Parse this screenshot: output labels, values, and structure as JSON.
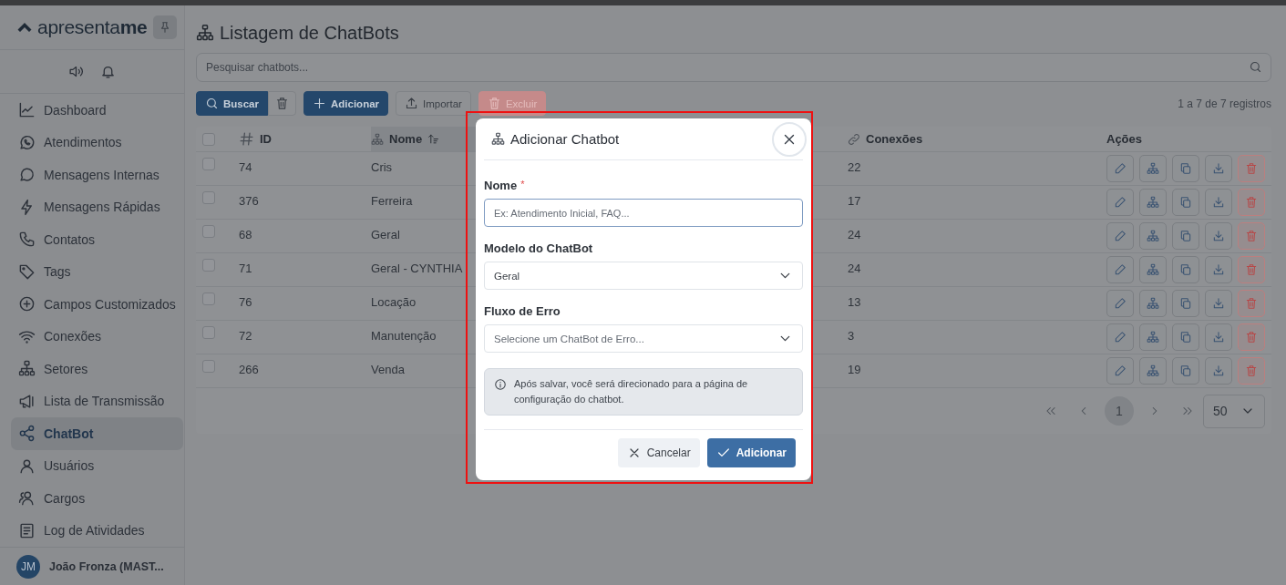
{
  "sidebar": {
    "logo": {
      "light": "apresenta",
      "bold": "me"
    },
    "items": [
      {
        "label": "Dashboard",
        "selected": false
      },
      {
        "label": "Atendimentos",
        "selected": false
      },
      {
        "label": "Mensagens Internas",
        "selected": false
      },
      {
        "label": "Mensagens Rápidas",
        "selected": false
      },
      {
        "label": "Contatos",
        "selected": false
      },
      {
        "label": "Tags",
        "selected": false
      },
      {
        "label": "Campos Customizados",
        "selected": false
      },
      {
        "label": "Conexões",
        "selected": false
      },
      {
        "label": "Setores",
        "selected": false
      },
      {
        "label": "Lista de Transmissão",
        "selected": false
      },
      {
        "label": "ChatBot",
        "selected": true
      },
      {
        "label": "Usuários",
        "selected": false
      },
      {
        "label": "Cargos",
        "selected": false
      },
      {
        "label": "Log de Atividades",
        "selected": false
      }
    ],
    "user": {
      "initials": "JM",
      "name": "João Fronza (MAST..."
    }
  },
  "page": {
    "title": "Listagem de ChatBots",
    "search": {
      "placeholder": "Pesquisar chatbots..."
    },
    "toolbar": [
      {
        "kind": "search",
        "label": "Buscar"
      },
      {
        "kind": "clear"
      },
      {
        "kind": "add",
        "label": "Adicionar"
      },
      {
        "kind": "import",
        "label": "Importar"
      },
      {
        "kind": "delete",
        "label": "Excluir",
        "disabled": true
      }
    ],
    "record_count": "1 a 7 de 7 registros",
    "table": {
      "header_checked": false,
      "columns": [
        {
          "kind": "id",
          "label": "ID",
          "sorted": false
        },
        {
          "kind": "name",
          "label": "Nome",
          "sorted": true
        },
        {
          "kind": "connections",
          "label": "Conexões",
          "sorted": false
        },
        {
          "kind": "actions",
          "label": "Ações",
          "sorted": false
        }
      ],
      "rows": [
        {
          "id": "74",
          "name": "Cris",
          "connections": "22",
          "selected": false
        },
        {
          "id": "376",
          "name": "Ferreira",
          "connections": "17",
          "selected": false
        },
        {
          "id": "68",
          "name": "Geral",
          "connections": "24",
          "selected": false
        },
        {
          "id": "71",
          "name": "Geral - CYNTHIA",
          "connections": "24",
          "selected": false
        },
        {
          "id": "76",
          "name": "Locação",
          "connections": "13",
          "selected": false
        },
        {
          "id": "72",
          "name": "Manutenção",
          "connections": "3",
          "selected": false
        },
        {
          "id": "266",
          "name": "Venda",
          "connections": "19",
          "selected": false
        }
      ]
    },
    "pagination": {
      "pages": [
        {
          "label": "1",
          "selected": true
        }
      ],
      "page_size": "50"
    }
  },
  "modal": {
    "title": "Adicionar Chatbot",
    "fields": [
      {
        "kind": "text",
        "label": "Nome",
        "required_mark": "*",
        "placeholder": "Ex: Atendimento Inicial, FAQ..."
      },
      {
        "kind": "select",
        "label": "Modelo do ChatBot",
        "value": "Geral"
      },
      {
        "kind": "select",
        "label": "Fluxo de Erro",
        "placeholder": "Selecione um ChatBot de Erro..."
      }
    ],
    "info": "Após salvar, você será direcionado para a página de configuração do chatbot.",
    "buttons": [
      {
        "kind": "cancel",
        "label": "Cancelar"
      },
      {
        "kind": "confirm",
        "label": "Adicionar"
      }
    ]
  }
}
